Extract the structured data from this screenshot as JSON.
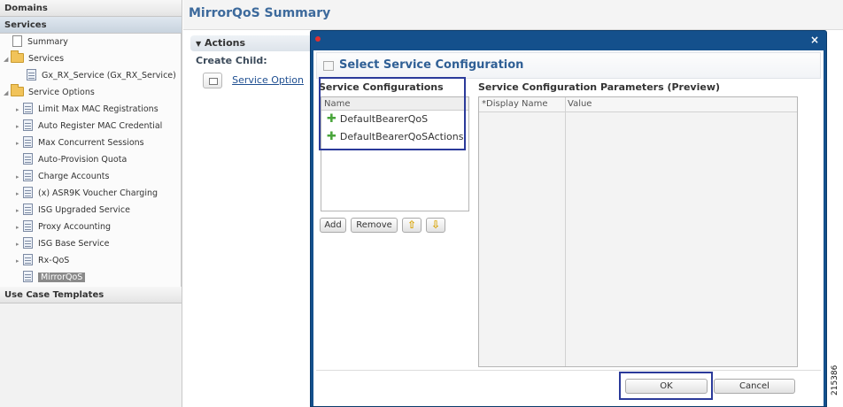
{
  "sidebar": {
    "domains_label": "Domains",
    "services_label": "Services",
    "use_case_label": "Use Case Templates",
    "tree": {
      "summary": "Summary",
      "services": "Services",
      "gx_service": "Gx_RX_Service (Gx_RX_Service)",
      "service_options": "Service Options",
      "options": [
        "Limit Max MAC Registrations",
        "Auto Register MAC Credential",
        "Max Concurrent Sessions",
        "Auto-Provision Quota",
        "Charge Accounts",
        "(x) ASR9K Voucher Charging",
        "ISG Upgraded Service",
        "Proxy Accounting",
        "ISG Base Service",
        "Rx-QoS",
        "MirrorQoS"
      ]
    }
  },
  "main": {
    "title": "MirrorQoS Summary",
    "actions_label": "Actions",
    "create_child_label": "Create Child:",
    "service_option_link": "Service Option"
  },
  "dialog": {
    "close_glyph": "×",
    "header": "Select Service Configuration",
    "service_configs_label": "Service Configurations",
    "params_label": "Service Configuration Parameters (Preview)",
    "list_column": "Name",
    "list_items": [
      "DefaultBearerQoS",
      "DefaultBearerQoSActions"
    ],
    "buttons": {
      "add": "Add",
      "remove": "Remove",
      "up": "⇧",
      "down": "⇩"
    },
    "preview_columns": [
      "*Display Name",
      "Value"
    ],
    "ok": "OK",
    "cancel": "Cancel"
  },
  "figure_number": "215386",
  "colors": {
    "dialog_frame": "#14508c",
    "title_text": "#3d6a9c",
    "highlight_box": "#2b3a9a"
  }
}
